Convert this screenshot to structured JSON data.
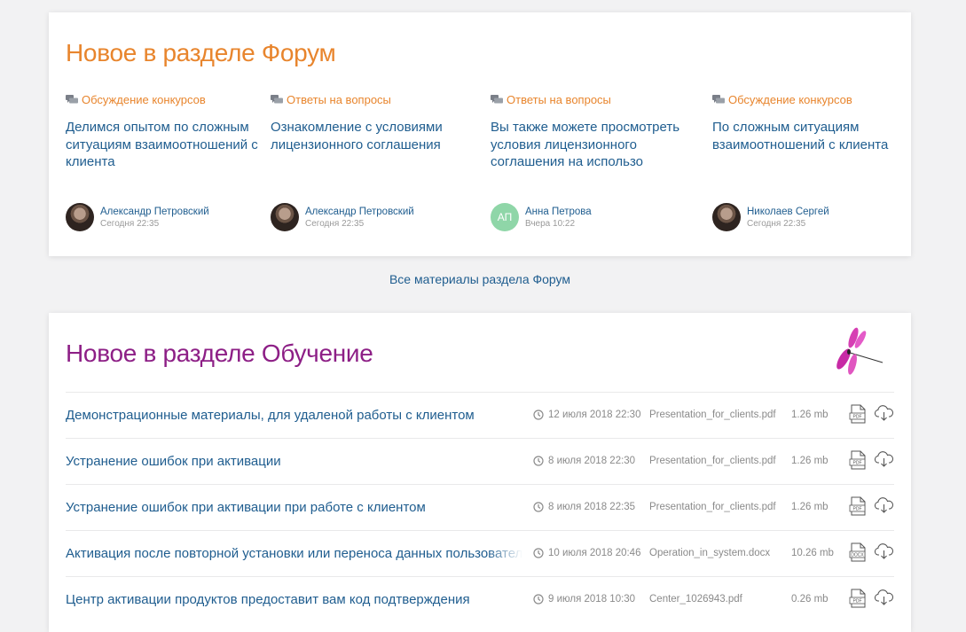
{
  "forum": {
    "title": "Новое в разделе Форум",
    "all_link": "Все материалы раздела Форум",
    "items": [
      {
        "category": "Обсуждение конкурсов",
        "text": "Делимся опытом по сложным ситуациям взаимоотношений с клиента",
        "author": "Александр Петровский",
        "time": "Сегодня 22:35",
        "avatar": "photo"
      },
      {
        "category": "Ответы на вопросы",
        "text": "Ознакомление с условиями лицензионного соглашения",
        "author": "Александр Петровский",
        "time": "Сегодня 22:35",
        "avatar": "photo"
      },
      {
        "category": "Ответы на вопросы",
        "text": "Вы также можете просмотреть условия лицензионного соглашения на использо",
        "author": "Анна Петрова",
        "time": "Вчера 10:22",
        "avatar": "initials",
        "initials": "АП"
      },
      {
        "category": "Обсуждение конкурсов",
        "text": "По сложным ситуациям взаимоотношений с клиента",
        "author": "Николаев Сергей",
        "time": "Сегодня 22:35",
        "avatar": "photo"
      }
    ]
  },
  "learning": {
    "title": "Новое в разделе Обучение",
    "rows": [
      {
        "title": "Демонстрационные материалы, для удаленой работы с клиентом",
        "date": "12 июля 2018 22:30",
        "file": "Presentation_for_clients.pdf",
        "size": "1.26 mb",
        "type": "PDF"
      },
      {
        "title": "Устранение ошибок при активации",
        "date": "8 июля 2018 22:30",
        "file": "Presentation_for_clients.pdf",
        "size": "1.26 mb",
        "type": "PDF"
      },
      {
        "title": "Устранение ошибок при активации при работе с клиентом",
        "date": "8 июля 2018 22:35",
        "file": "Presentation_for_clients.pdf",
        "size": "1.26 mb",
        "type": "PDF"
      },
      {
        "title": "Активация после повторной установки или переноса данных пользователя",
        "date": "10 июля 2018 20:46",
        "file": "Operation_in_system.docx",
        "size": "10.26 mb",
        "type": "DOCX"
      },
      {
        "title": "Центр активации продуктов предоставит вам код подтверждения",
        "date": "9 июля 2018 10:30",
        "file": "Center_1026943.pdf",
        "size": "0.26 mb",
        "type": "PDF"
      }
    ]
  },
  "colors": {
    "forum_accent": "#e8852d",
    "learning_accent": "#8d1f86",
    "link": "#1f5d8f"
  }
}
